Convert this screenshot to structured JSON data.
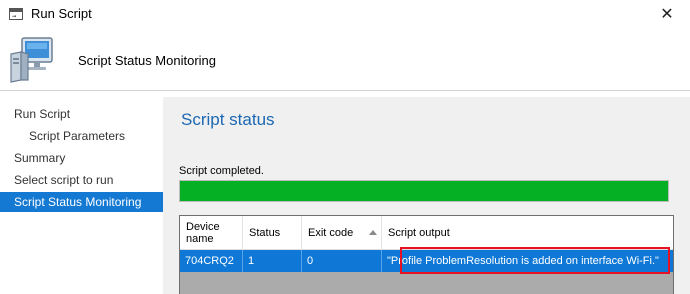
{
  "window": {
    "title": "Run Script",
    "close_label": "✕"
  },
  "header": {
    "title": "Script Status Monitoring"
  },
  "sidebar": {
    "items": [
      {
        "label": "Run Script"
      },
      {
        "label": "Script Parameters"
      },
      {
        "label": "Summary"
      },
      {
        "label": "Select script to run"
      },
      {
        "label": "Script Status Monitoring"
      }
    ]
  },
  "main": {
    "section_title": "Script status",
    "status_text": "Script completed.",
    "progress_fraction": 1.0,
    "progress_color": "#06b025",
    "accent_color": "#1479d2"
  },
  "table": {
    "columns": [
      "Device name",
      "Status",
      "Exit code",
      "Script output"
    ],
    "sorted_column": "Exit code",
    "rows": [
      {
        "device_name": "704CRQ2",
        "status": "1",
        "exit_code": "0",
        "script_output": "\"Profile ProblemResolution is added on interface Wi-Fi.\""
      }
    ]
  },
  "icons": {
    "app": "run-script-window-icon",
    "header": "computer-monitor-icon",
    "sort": "sort-ascending-icon",
    "close": "close-icon"
  }
}
